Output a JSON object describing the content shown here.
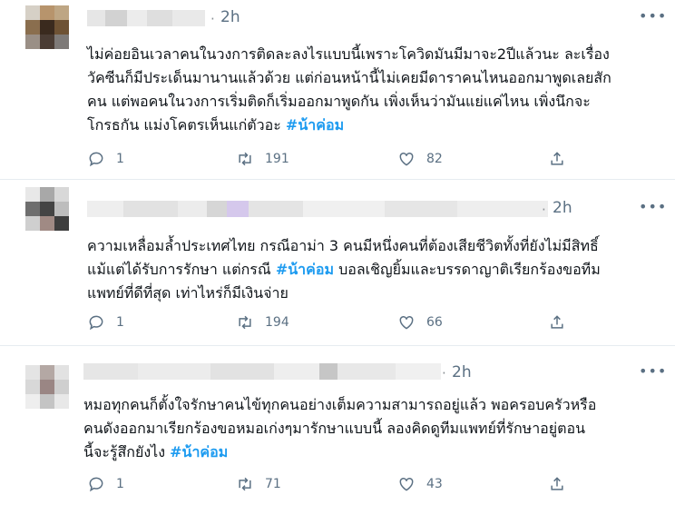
{
  "tweets": [
    {
      "time": "2h",
      "lines": [
        "ไม่ค่อยอินเวลาคนในวงการติดละลงไรแบบนี้เพราะโควิดมันมีมาจะ2ปีแล้วนะ ละเรื่อง",
        "วัคซีนก็มีประเด็นมานานแล้วด้วย แต่ก่อนหน้านี้ไม่เคยมีดาราคนไหนออกมาพูดเลยสัก",
        "คน แต่พอคนในวงการเริ่มติดก็เริ่มออกมาพูดกัน เพิ่งเห็นว่ามันแย่แค่ไหน เพิ่งนึกจะ",
        "โกรธกัน แม่งโคตรเห็นแก่ตัวอะ "
      ],
      "hashtag": "#น้าค่อม",
      "replies": "1",
      "retweets": "191",
      "likes": "82"
    },
    {
      "time": "2h",
      "lines": [
        "ความเหลื่อมล้ำประเทศไทย กรณีอาม่า 3 คนมีหนึ่งคนที่ต้องเสียชีวิตทั้งที่ยังไม่มีสิทธิ์",
        "แม้แต่ได้รับการรักษา แต่กรณี ",
        "แพทย์ที่ดีที่สุด เท่าไหร่ก็มีเงินจ่าย"
      ],
      "hashtag": "#น้าค่อม",
      "after_hashtag": " บอลเชิญยิ้มและบรรดาญาติเรียกร้องขอทีม",
      "replies": "1",
      "retweets": "194",
      "likes": "66"
    },
    {
      "time": "2h",
      "lines": [
        "หมอทุกคนก็ตั้งใจรักษาคนไข้ทุกคนอย่างเต็มความสามารถอยู่แล้ว พอครอบครัวหรือ",
        "คนดังออกมาเรียกร้องขอหมอเก่งๆมารักษาแบบนี้ ลองคิดดูทีมแพทย์ที่รักษาอยู่ตอน",
        "นี้จะรู้สึกยังไง "
      ],
      "hashtag": "#น้าค่อม",
      "replies": "1",
      "retweets": "71",
      "likes": "43"
    }
  ],
  "icons": {
    "reply": "reply-icon",
    "retweet": "retweet-icon",
    "like": "heart-icon",
    "share": "share-icon",
    "more": "more-icon"
  },
  "colors": {
    "hashtag": "#1d9bf0",
    "secondary_text": "#5b7083",
    "divider": "#e6ecf0"
  }
}
